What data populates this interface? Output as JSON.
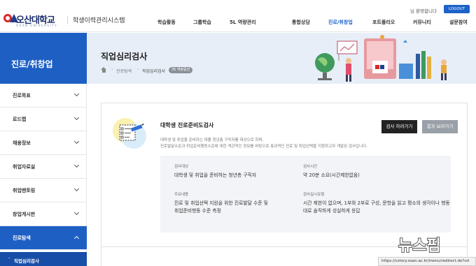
{
  "header": {
    "logo_text": "오산대학교",
    "logo_eng": "OSAN UNIVERSITY",
    "system_title": "학생이력관리시스템",
    "welcome": "님 환영합니다",
    "logout_label": "LOGOUT",
    "nav": [
      "학습활동",
      "그룹학습",
      "5L 역량관리",
      "통합상담",
      "진로/취창업",
      "포트폴리오",
      "커뮤니티",
      "설문참여"
    ],
    "nav_active_index": 4
  },
  "banner": {
    "section_title": "진로/취창업",
    "page_title": "직업심리검사",
    "breadcrumb": [
      "진로탐색",
      "직업심리검사"
    ],
    "breadcrumb_badge": "35 역량증진"
  },
  "sidebar": {
    "items": [
      {
        "label": "진로목표"
      },
      {
        "label": "로드맵"
      },
      {
        "label": "채용정보"
      },
      {
        "label": "취업자료실"
      },
      {
        "label": "취업멘토링"
      },
      {
        "label": "창업게시판"
      },
      {
        "label": "진로탐색"
      }
    ],
    "active_item": "진로탐색",
    "sub_item": "직업심리검사"
  },
  "card": {
    "title": "대학생 진로준비도검사",
    "start_button": "검사 하러가기",
    "result_button": "결과 보러가기",
    "desc_line1": "대학생 및 취업을 준비하는 대졸 청년층 구직자를 대상으로 하며,",
    "desc_line2": "진로발달수준과 취업준비행동수준에 대한 객관적인 정보를 바탕으로 효과적인 진로 및 취업선택을 지원하고자 개발된 검사입니다.",
    "target_label": "검사대상",
    "target_value": "대학생 및 취업을 준비하는 청년층 구직자",
    "time_label": "검사시간",
    "time_value": "약 20분 소요(시간제한없음)",
    "content_label": "주요내용",
    "content_value_1": "진로 및 취업선택 지원을 위한 진로발달 수준 및",
    "content_value_2": "취업준비행동 수준 측정",
    "method_label": "검사실시유형",
    "method_value_1": "시간 제한이 없으며, 1부와 2부로 구성, 문항을 읽고 평소의 생각이나 행동",
    "method_value_2": "대로 솔직하게 성실하게 응답"
  },
  "watermark": "뉴스핌",
  "status_url": "https://cstory.osan.ac.kr/menu/redirect.do?url"
}
